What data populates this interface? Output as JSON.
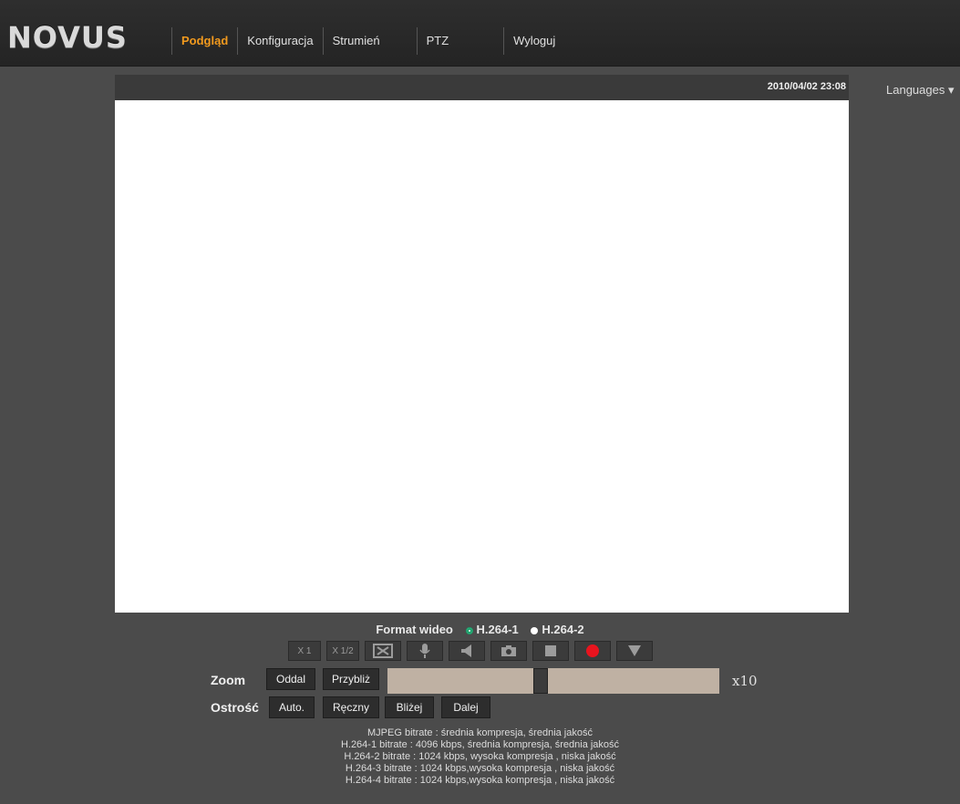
{
  "brand": {
    "logo": "NOVUS"
  },
  "nav": {
    "items": [
      {
        "label": "Podgląd",
        "active": true
      },
      {
        "label": "Konfiguracja",
        "active": false
      },
      {
        "label": "Strumień",
        "active": false
      },
      {
        "label": "PTZ",
        "active": false
      },
      {
        "label": "Wyloguj",
        "active": false
      }
    ]
  },
  "languages": {
    "label": "Languages ▾"
  },
  "video": {
    "timestamp": "2010/04/02 23:08"
  },
  "format": {
    "label": "Format wideo",
    "options": [
      {
        "label": "H.264-1",
        "selected": true
      },
      {
        "label": "H.264-2",
        "selected": false
      }
    ]
  },
  "toolbar": {
    "buttons": [
      {
        "name": "x1-button",
        "label": "X 1",
        "icon": "text"
      },
      {
        "name": "x1-2-button",
        "label": "X 1/2",
        "icon": "text"
      },
      {
        "name": "fullscreen-button",
        "label": "",
        "icon": "fullscreen-icon"
      },
      {
        "name": "microphone-button",
        "label": "",
        "icon": "microphone-icon"
      },
      {
        "name": "speaker-button",
        "label": "",
        "icon": "speaker-icon"
      },
      {
        "name": "snapshot-button",
        "label": "",
        "icon": "camera-icon"
      },
      {
        "name": "stop-button",
        "label": "",
        "icon": "stop-icon"
      },
      {
        "name": "record-button",
        "label": "",
        "icon": "record-icon"
      },
      {
        "name": "dropdown-button",
        "label": "",
        "icon": "triangle-down-icon"
      }
    ],
    "colors": {
      "record": "#e8141e",
      "icon": "#9c9c9c"
    }
  },
  "zoom": {
    "label": "Zoom",
    "out_label": "Oddal",
    "in_label": "Przybliż",
    "multiplier": "x10",
    "level_fraction": 0.46
  },
  "focus": {
    "label": "Ostrość",
    "auto_label": "Auto.",
    "manual_label": "Ręczny",
    "near_label": "Bliżej",
    "far_label": "Dalej"
  },
  "bitrates": [
    "MJPEG bitrate : średnia kompresja, średnia jakość",
    "H.264-1 bitrate : 4096 kbps, średnia kompresja, średnia jakość",
    "H.264-2 bitrate : 1024 kbps, wysoka kompresja , niska jakość",
    "H.264-3 bitrate : 1024 kbps,wysoka kompresja , niska jakość",
    "H.264-4 bitrate : 1024 kbps,wysoka kompresja , niska jakość"
  ],
  "colors": {
    "accent": "#f29a1e",
    "background": "#4b4b4b",
    "slider": "#bfb1a3"
  }
}
